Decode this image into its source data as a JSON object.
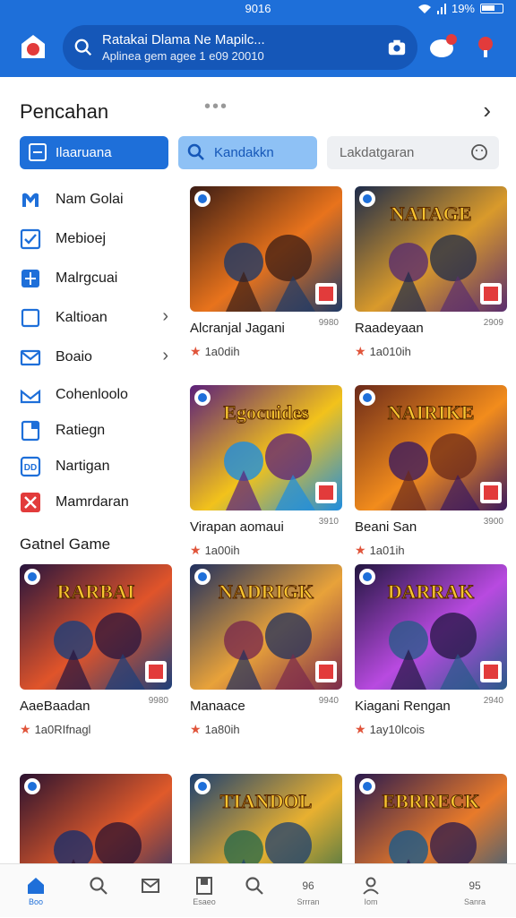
{
  "status": {
    "time": "9016",
    "battery": "19%"
  },
  "search": {
    "line1": "Ratakai Dlama Ne Mapilc...",
    "line2": "Aplinea gem agee 1 e09 20010"
  },
  "header": {
    "title": "Pencahan",
    "dots": "•••"
  },
  "tabs": [
    {
      "label": "Ilaaruana",
      "active": true
    },
    {
      "label": "Kandakkn"
    },
    {
      "label": "Lakdatgaran"
    }
  ],
  "sidebar": {
    "items": [
      {
        "label": "Nam Golai",
        "icon": "m-logo-icon"
      },
      {
        "label": "Mebioej",
        "icon": "checkbox-icon"
      },
      {
        "label": "Malrgcuai",
        "icon": "grid-icon"
      },
      {
        "label": "Kaltioan",
        "icon": "square-outline-icon",
        "arrow": true
      },
      {
        "label": "Boaio",
        "icon": "mail-icon",
        "arrow": true
      },
      {
        "label": "Cohenloolo",
        "icon": "mail-open-icon"
      },
      {
        "label": "Ratiegn",
        "icon": "document-icon"
      },
      {
        "label": "Nartigan",
        "icon": "dd-icon"
      },
      {
        "label": "Mamrdaran",
        "icon": "x-badge-icon"
      }
    ]
  },
  "section_title": "Gatnel Game",
  "games": [
    {
      "name": "Alcranjal Jagani",
      "count": "9980",
      "rating": "1a0dih",
      "banner": "",
      "colors": [
        "#3b1c14",
        "#e8731c",
        "#1f3a66"
      ]
    },
    {
      "name": "Raadeyaan",
      "count": "2909",
      "rating": "1a010ih",
      "banner": "NATAGE",
      "colors": [
        "#1d2b4a",
        "#d99a2b",
        "#5a2d6e"
      ]
    },
    {
      "name": "Virapan aomaui",
      "count": "3910",
      "rating": "1a00ih",
      "banner": "Egocuides",
      "colors": [
        "#5b1f7a",
        "#f2c21b",
        "#1d8de0"
      ]
    },
    {
      "name": "Beani San",
      "count": "3900",
      "rating": "1a01ih",
      "banner": "NAIRIKE",
      "colors": [
        "#6b2a1a",
        "#f28c1c",
        "#3c1a5e"
      ]
    },
    {
      "name": "AaeBaadan",
      "count": "9980",
      "rating": "1a0RIfnagl",
      "banner": "RARBAI",
      "colors": [
        "#26143d",
        "#e0542a",
        "#1c3f7a"
      ]
    },
    {
      "name": "Manaace",
      "count": "9940",
      "rating": "1a80ih",
      "banner": "NADRIGK",
      "colors": [
        "#1f2f5e",
        "#e8a23a",
        "#7a2a4c"
      ]
    },
    {
      "name": "Kiagani Rengan",
      "count": "2940",
      "rating": "1ay10lcois",
      "banner": "DARRAK",
      "colors": [
        "#221640",
        "#b84ae0",
        "#2a5a8a"
      ]
    },
    {
      "name": "",
      "count": "",
      "rating": "",
      "banner": "",
      "colors": [
        "#2a1230",
        "#e05a2a",
        "#1a2e6b"
      ]
    },
    {
      "name": "",
      "count": "",
      "rating": "",
      "banner": "TIANDOL",
      "colors": [
        "#1c3f70",
        "#e8b030",
        "#2a6a4a"
      ]
    },
    {
      "name": "",
      "count": "",
      "rating": "",
      "banner": "EBRRECK",
      "colors": [
        "#2a1a4e",
        "#e87a2a",
        "#1a5a8a"
      ]
    }
  ],
  "nav": [
    {
      "label": "Boo",
      "icon": "home-icon",
      "active": true
    },
    {
      "label": "",
      "icon": "search-icon"
    },
    {
      "label": "",
      "icon": "mail-icon"
    },
    {
      "label": "Esaeo",
      "icon": "bookmark-icon"
    },
    {
      "label": "",
      "icon": "search-icon"
    },
    {
      "label": "Srrran",
      "icon": "controller-icon"
    },
    {
      "label": "Iom",
      "icon": "user-icon"
    },
    {
      "label": "Sanra",
      "icon": "settings-icon"
    }
  ],
  "colors": {
    "primary": "#1e6fd9",
    "primary_dark": "#1557b8",
    "tab_light": "#8ec1f5",
    "star": "#e0543a"
  }
}
